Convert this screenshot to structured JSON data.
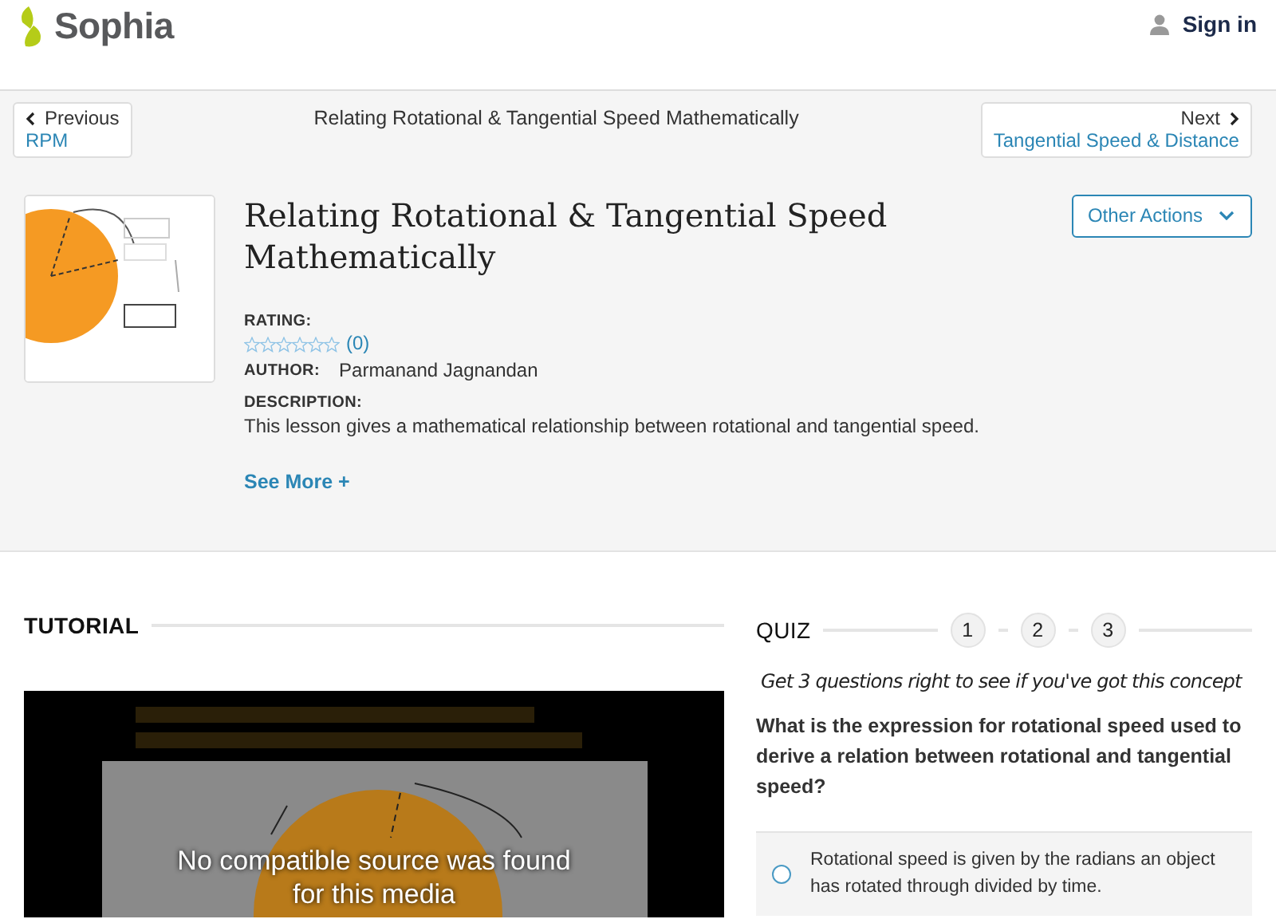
{
  "header": {
    "logo": "Sophia",
    "sign_in": "Sign in"
  },
  "nav": {
    "previous_label": "Previous",
    "previous_title": "RPM",
    "current_title": "Relating Rotational & Tangential Speed Mathematically",
    "next_label": "Next",
    "next_title": "Tangential Speed & Distance"
  },
  "lesson": {
    "title": "Relating Rotational & Tangential Speed Mathematically",
    "other_actions": "Other Actions",
    "rating_label": "RATING:",
    "stars": 0,
    "rating_count": "(0)",
    "author_label": "AUTHOR:",
    "author": "Parmanand Jagnandan",
    "description_label": "DESCRIPTION:",
    "description": "This lesson gives a mathematical relationship between rotational and tangential speed.",
    "see_more": "See More +"
  },
  "tutorial": {
    "heading": "TUTORIAL",
    "video": {
      "message_lines": [
        "No compatible source was found",
        "for this media"
      ]
    }
  },
  "quiz": {
    "heading": "QUIZ",
    "steps": [
      "1",
      "2",
      "3"
    ],
    "prompt": "Get 3 questions right to see if you've got this concept",
    "question": "What is the expression for rotational speed used to derive a relation between rotational and tangential speed?",
    "answers": [
      {
        "text": "Rotational speed is given by the radians an object has rotated through divided by time.",
        "selected": false
      }
    ]
  }
}
